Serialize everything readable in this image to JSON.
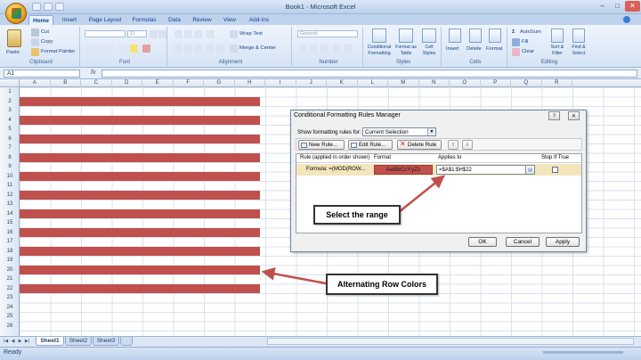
{
  "window": {
    "title": "Book1 - Microsoft Excel",
    "controls": [
      "–",
      "□",
      "✕"
    ]
  },
  "tabs": [
    "Home",
    "Insert",
    "Page Layout",
    "Formulas",
    "Data",
    "Review",
    "View",
    "Add-Ins"
  ],
  "ribbon": {
    "clipboard": {
      "label": "Clipboard",
      "paste": "Paste",
      "cut": "Cut",
      "copy": "Copy",
      "format_painter": "Format Painter"
    },
    "font": {
      "label": "Font",
      "font_size": "11"
    },
    "alignment": {
      "label": "Alignment",
      "wrap_text": "Wrap Text",
      "merge_center": "Merge & Center"
    },
    "number": {
      "label": "Number",
      "format": "General"
    },
    "styles": {
      "label": "Styles",
      "conditional_formatting": "Conditional Formatting",
      "format_as_table": "Format as Table",
      "cell_styles": "Cell Styles"
    },
    "cells": {
      "label": "Cells",
      "insert": "Insert",
      "delete": "Delete",
      "format": "Format"
    },
    "editing": {
      "label": "Editing",
      "autosum": "AutoSum",
      "fill": "Fill",
      "clear": "Clear",
      "sort_filter": "Sort & Filter",
      "find_select": "Find & Select"
    }
  },
  "formula_bar": {
    "name_box": "A1",
    "fx": "fx",
    "formula": ""
  },
  "columns": [
    "A",
    "B",
    "C",
    "D",
    "E",
    "F",
    "G",
    "H",
    "I",
    "J",
    "K",
    "L",
    "M",
    "N",
    "O",
    "P",
    "Q",
    "R"
  ],
  "rows": [
    "1",
    "2",
    "3",
    "4",
    "5",
    "6",
    "7",
    "8",
    "9",
    "10",
    "11",
    "12",
    "13",
    "14",
    "15",
    "16",
    "17",
    "18",
    "19",
    "20",
    "21",
    "22",
    "23",
    "24",
    "25",
    "26"
  ],
  "stripe_rows": [
    2,
    4,
    6,
    8,
    10,
    12,
    14,
    16,
    18,
    20,
    22
  ],
  "stripe_color": "#c0504d",
  "sheets": [
    "Sheet1",
    "Sheet2",
    "Sheet3"
  ],
  "status": "Ready",
  "dialog": {
    "title": "Conditional Formatting Rules Manager",
    "help": "?",
    "close": "✕",
    "show_rules_label": "Show formatting rules for:",
    "show_rules_value": "Current Selection",
    "new_rule": "New Rule...",
    "edit_rule": "Edit Rule...",
    "delete_rule": "Delete Rule",
    "move_up": "⇧",
    "move_down": "⇩",
    "headers": {
      "rule": "Rule (applied in order shown)",
      "format": "Format",
      "applies_to": "Applies to",
      "stop_if_true": "Stop If True"
    },
    "rule": {
      "text": "Formula: =(MOD(ROW...",
      "format_preview": "AaBbCcYyZz",
      "applies_to": "=$A$1:$H$22"
    },
    "ok": "OK",
    "cancel": "Cancel",
    "apply": "Apply"
  },
  "callouts": {
    "select_range": "Select the range",
    "alternating": "Alternating Row Colors"
  }
}
